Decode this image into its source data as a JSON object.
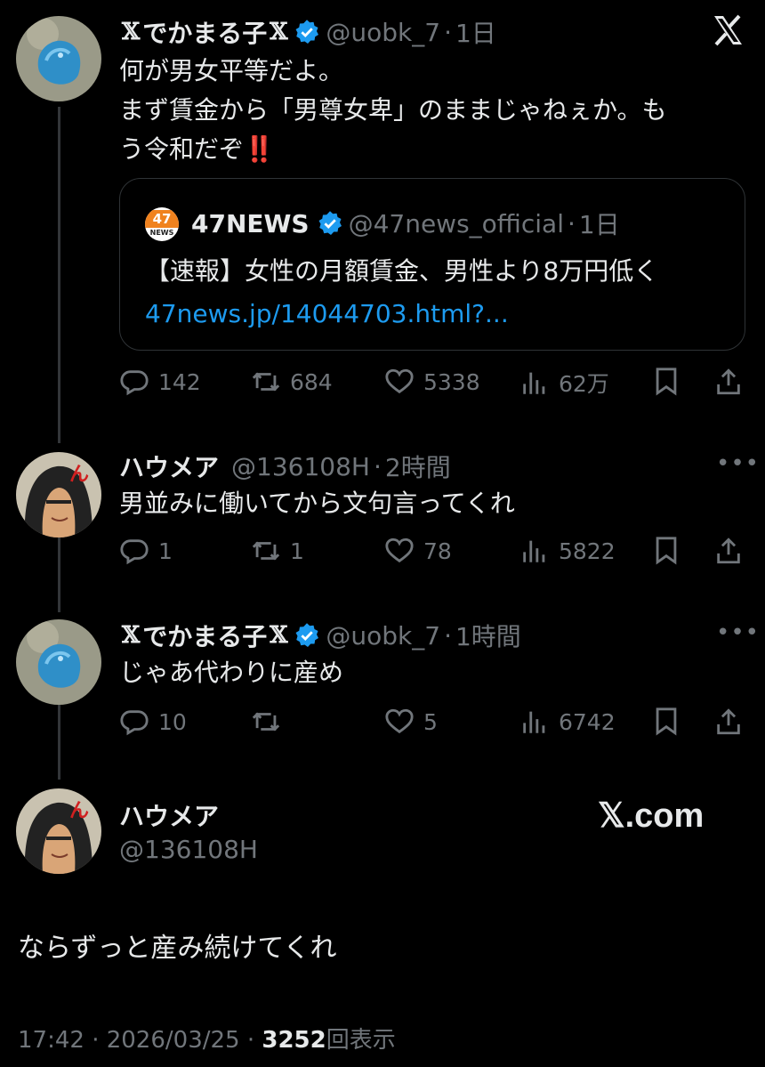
{
  "tweet1": {
    "name": "でかまる子",
    "handle": "@uobk_7",
    "time": "1日",
    "lines": [
      "何が男女平等だよ。",
      "まず賃金から「男尊女卑」のままじゃねぇか。も",
      "う令和だぞ‼️"
    ],
    "quote": {
      "logo_text": "47",
      "logo_sub": "NEWS",
      "name": "47NEWS",
      "handle": "@47news_official",
      "time": "1日",
      "text": "【速報】女性の月額賃金、男性より8万円低く",
      "link": "47news.jp/14044703.html?..."
    },
    "replies": "142",
    "retweets": "684",
    "likes": "5338",
    "views": "62万"
  },
  "tweet2": {
    "name": "ハウメア",
    "handle": "@136108H",
    "time": "2時間",
    "text": "男並みに働いてから文句言ってくれ",
    "replies": "1",
    "retweets": "1",
    "likes": "78",
    "views": "5822"
  },
  "tweet3": {
    "name": "でかまる子",
    "handle": "@uobk_7",
    "time": "1時間",
    "text": "じゃあ代わりに産め",
    "replies": "10",
    "retweets": "",
    "likes": "5",
    "views": "6742"
  },
  "main": {
    "name": "ハウメア",
    "handle": "@136108H",
    "brand": "𝕏.com",
    "text": "ならずっと産み続けてくれ",
    "timestamp": "17:42 · 2026/03/25 · ",
    "views_count": "3252",
    "views_label": "回表示"
  },
  "x_glyph": "𝕏",
  "dot": "·",
  "more": "•••",
  "colors": {
    "accent": "#1d9bf0",
    "muted": "#71767b",
    "bg": "#000000"
  }
}
